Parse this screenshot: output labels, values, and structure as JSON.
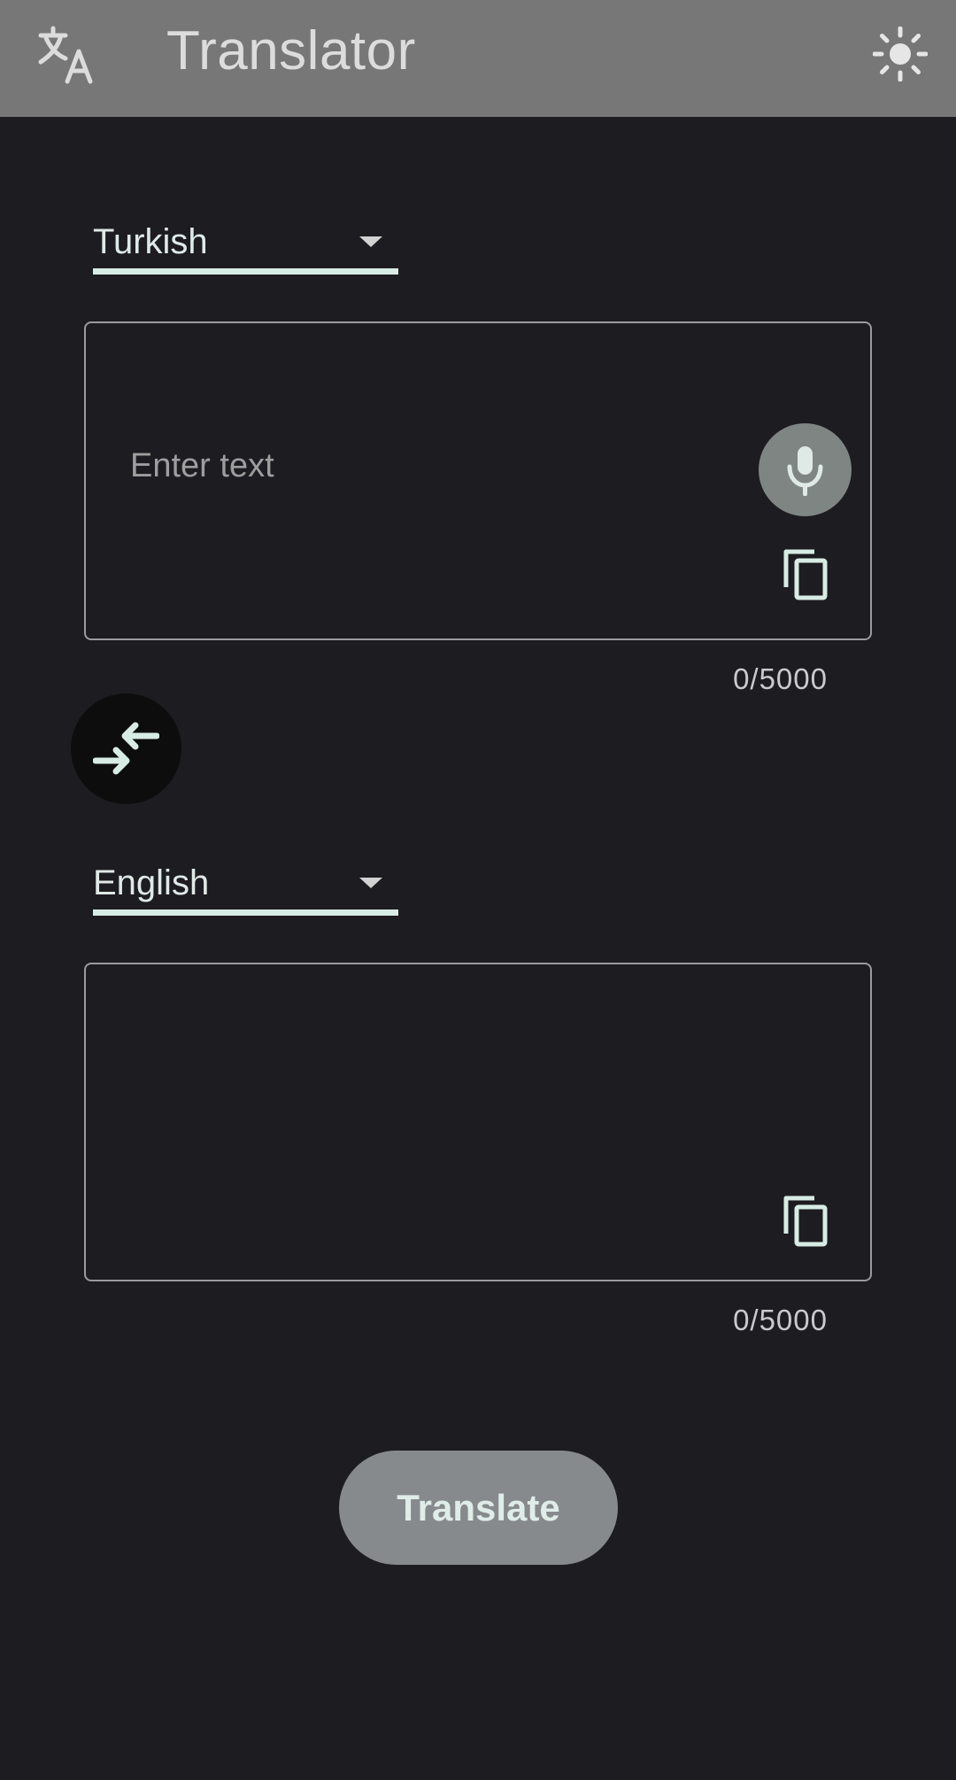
{
  "appbar": {
    "title": "Translator",
    "logo_icon": "translate-icon",
    "theme_icon": "sun-icon"
  },
  "source": {
    "language": "Turkish",
    "placeholder": "Enter text",
    "counter": "0/5000",
    "mic_icon": "microphone-icon",
    "copy_icon": "copy-icon"
  },
  "swap_icon": "swap-arrows-icon",
  "target": {
    "language": "English",
    "counter": "0/5000",
    "copy_icon": "copy-icon"
  },
  "translate_label": "Translate",
  "colors": {
    "background": "#1d1c20",
    "appbar": "#777777",
    "accent": "#d7ece4",
    "button": "#868a8c"
  }
}
